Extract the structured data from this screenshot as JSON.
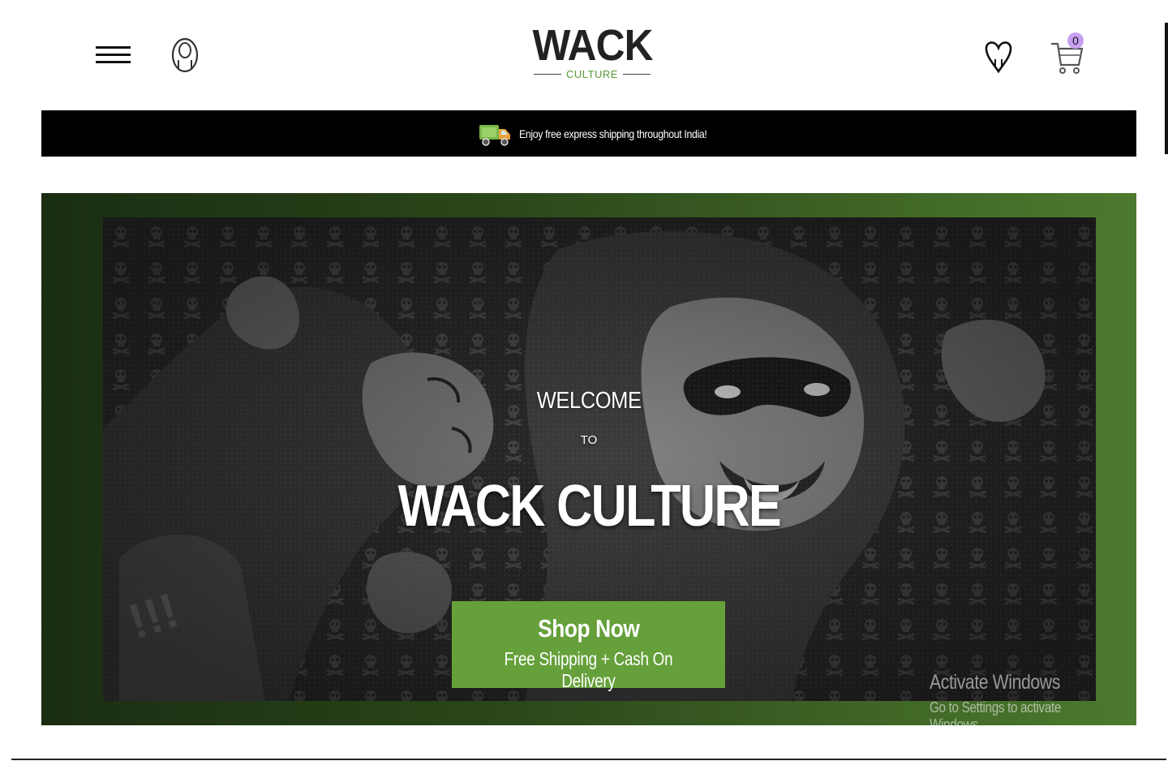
{
  "header": {
    "logo_main": "WACK",
    "logo_sub": "CULTURE",
    "cart_count": "0",
    "icons": {
      "menu": "hamburger-menu-icon",
      "account": "user-icon",
      "wishlist": "heart-icon",
      "cart": "cart-icon"
    }
  },
  "shipping_banner": {
    "text": "Enjoy free express shipping throughout India!",
    "icon": "truck-icon"
  },
  "hero": {
    "welcome": "WELCOME",
    "to": "TO",
    "headline": "WACK CULTURE",
    "button_title": "Shop Now",
    "button_subtitle": "Free Shipping + Cash On Delivery"
  },
  "os_watermark": {
    "title": "Activate Windows",
    "subtitle": "Go to Settings to activate Windows."
  },
  "colors": {
    "accent_green": "#65a03a",
    "banner_black": "#000000",
    "badge": "#c79ff0"
  }
}
